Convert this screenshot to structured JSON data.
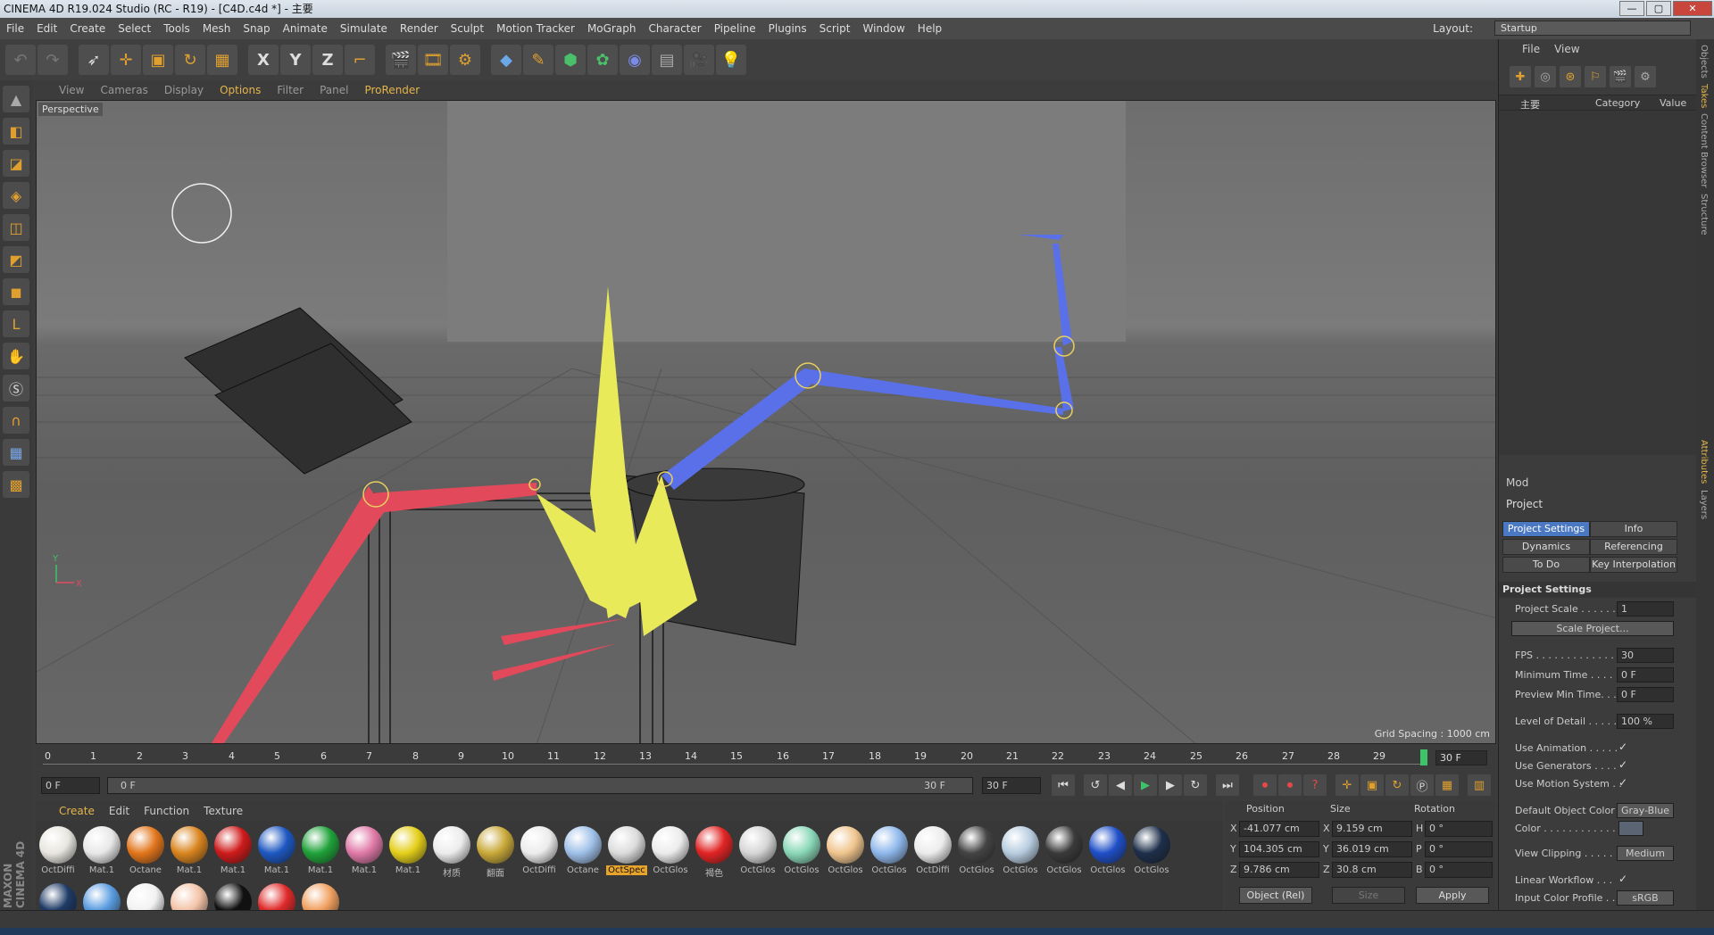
{
  "window": {
    "title": "CINEMA 4D R19.024 Studio (RC - R19) - [C4D.c4d *] - 主要",
    "controls": [
      "—",
      "▢",
      "✕"
    ]
  },
  "menubar": {
    "items": [
      "File",
      "Edit",
      "Create",
      "Select",
      "Tools",
      "Mesh",
      "Snap",
      "Animate",
      "Simulate",
      "Render",
      "Sculpt",
      "Motion Tracker",
      "MoGraph",
      "Character",
      "Pipeline",
      "Plugins",
      "Script",
      "Window",
      "Help"
    ],
    "layout_label": "Layout:",
    "layout_value": "Startup"
  },
  "viewport": {
    "menu": [
      "View",
      "Cameras",
      "Display",
      "Options",
      "Filter",
      "Panel",
      "ProRender"
    ],
    "active_menu": "Options",
    "label": "Perspective",
    "grid_spacing": "Grid Spacing : 1000 cm",
    "axis_labels": {
      "y": "Y",
      "x": "X"
    }
  },
  "timeline": {
    "ticks": [
      "0",
      "1",
      "2",
      "3",
      "4",
      "5",
      "6",
      "7",
      "8",
      "9",
      "10",
      "11",
      "12",
      "13",
      "14",
      "15",
      "16",
      "17",
      "18",
      "19",
      "20",
      "21",
      "22",
      "23",
      "24",
      "25",
      "26",
      "27",
      "28",
      "29"
    ],
    "current_frame_box": "30 F"
  },
  "transport": {
    "start_field": "0 F",
    "range_start": "0 F",
    "range_end": "30 F",
    "end_field": "30 F"
  },
  "material_manager": {
    "menu": [
      "Create",
      "Edit",
      "Function",
      "Texture"
    ],
    "active_menu": "Create",
    "row1": [
      {
        "name": "OctDiffi",
        "color": "#e8e6df"
      },
      {
        "name": "Mat.1",
        "color": "#e8e8e8"
      },
      {
        "name": "Octane",
        "color": "#e2761c"
      },
      {
        "name": "Mat.1",
        "color": "#d9851f"
      },
      {
        "name": "Mat.1",
        "color": "#cf1b1b"
      },
      {
        "name": "Mat.1",
        "color": "#1e58c2"
      },
      {
        "name": "Mat.1",
        "color": "#1fa23a"
      },
      {
        "name": "Mat.1",
        "color": "#e07aa8"
      },
      {
        "name": "Mat.1",
        "color": "#e4cf1a"
      },
      {
        "name": "材质",
        "color": "#ececec"
      },
      {
        "name": "翻面",
        "color": "#c9a93a"
      },
      {
        "name": "OctDiffi",
        "color": "#ececec"
      },
      {
        "name": "Octane",
        "color": "#9fc0e8"
      },
      {
        "name": "OctSpec",
        "color": "#dcdcdc",
        "selected": true
      },
      {
        "name": "OctGlos",
        "color": "#ececec"
      },
      {
        "name": "褐色",
        "color": "#e22424"
      },
      {
        "name": "OctGlos",
        "color": "#d6d6d6"
      },
      {
        "name": "OctGlos",
        "color": "#8ad8b8"
      },
      {
        "name": "OctGlos",
        "color": "#f0c58e"
      },
      {
        "name": "OctGlos",
        "color": "#8fb8ec"
      },
      {
        "name": "OctDiffi",
        "color": "#ececec"
      },
      {
        "name": "OctGlos",
        "color": "#444"
      },
      {
        "name": "OctGlos",
        "color": "#b7cde0"
      },
      {
        "name": "OctGlos",
        "color": "#3a3a3a"
      },
      {
        "name": "OctGlos",
        "color": "#1f4fc8"
      },
      {
        "name": "OctGlos",
        "color": "#1e2f4a"
      }
    ],
    "row2": [
      {
        "color": "#1e3a66"
      },
      {
        "color": "#5a9ce0"
      },
      {
        "color": "#f2f2f2"
      },
      {
        "color": "#f3c4a8"
      },
      {
        "color": "#111"
      },
      {
        "color": "#e02a2a"
      },
      {
        "color": "#f0a060"
      }
    ]
  },
  "coordinates": {
    "headers": [
      "Position",
      "Size",
      "Rotation"
    ],
    "rows": [
      {
        "axis": "X",
        "pos": "-41.077 cm",
        "size_axis": "X",
        "size": "9.159 cm",
        "rot_axis": "H",
        "rot": "0 °"
      },
      {
        "axis": "Y",
        "pos": "104.305 cm",
        "size_axis": "Y",
        "size": "36.019 cm",
        "rot_axis": "P",
        "rot": "0 °"
      },
      {
        "axis": "Z",
        "pos": "9.786 cm",
        "size_axis": "Z",
        "size": "30.8 cm",
        "rot_axis": "B",
        "rot": "0 °"
      }
    ],
    "mode_select": "Object (Rel)",
    "size_select": "Size",
    "apply_button": "Apply"
  },
  "objects_panel": {
    "menu": [
      "File",
      "View"
    ],
    "columns": [
      "主要",
      "Category",
      "Value"
    ]
  },
  "attributes": {
    "mode_label": "Mod",
    "title": "Project",
    "tabs": [
      {
        "label": "Project Settings",
        "active": true
      },
      {
        "label": "Info"
      },
      {
        "label": "Dynamics"
      },
      {
        "label": "Referencing"
      },
      {
        "label": "To Do"
      },
      {
        "label": "Key Interpolation"
      }
    ],
    "section": "Project Settings",
    "project_scale_label": "Project Scale . . . . . .",
    "project_scale_value": "1",
    "scale_project_button": "Scale Project...",
    "fps_label": "FPS . . . . . . . . . . . . . .",
    "fps_value": "30",
    "min_time_label": "Minimum Time . . . . .",
    "min_time_value": "0 F",
    "preview_min_label": "Preview Min Time. . .",
    "preview_min_value": "0 F",
    "lod_label": "Level of Detail . . . . .",
    "lod_value": "100 %",
    "use_animation": "Use Animation . . . . .",
    "use_generators": "Use Generators . . . .",
    "use_motion": "Use Motion System . .",
    "check": "✓",
    "default_color_label": "Default Object Color",
    "default_color_value": "Gray-Blue",
    "color_label": "Color . . . . . . . . . . . . .",
    "view_clipping_label": "View Clipping . . . . .",
    "view_clipping_value": "Medium",
    "linear_workflow": "Linear Workflow . . .",
    "input_color_label": "Input Color Profile . .",
    "input_color_value": "sRGB"
  },
  "side_tabs": [
    "Objects",
    "Takes",
    "Content Browser",
    "Structure",
    "Attributes",
    "Layers"
  ],
  "brand": "MAXON CINEMA 4D",
  "colors": {
    "accent": "#e4b54b",
    "selected_tab": "#4b78c2",
    "playhead": "#3ec36a"
  }
}
